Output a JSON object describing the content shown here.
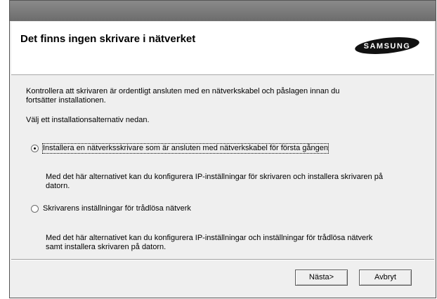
{
  "header": {
    "title": "Det finns ingen skrivare i nätverket",
    "logo_text": "SAMSUNG"
  },
  "content": {
    "intro_line1": "Kontrollera att skrivaren är ordentligt ansluten med en nätverkskabel och påslagen innan du",
    "intro_line2": "fortsätter installationen.",
    "select_prompt": "Välj ett installationsalternativ nedan.",
    "option1": {
      "label": "Installera en nätverksskrivare som är ansluten med nätverkskabel för första gången",
      "selected": true,
      "desc_line1": "Med det här alternativet kan du konfigurera IP-inställningar för skrivaren och installera skrivaren på",
      "desc_line2": "datorn."
    },
    "option2": {
      "label": "Skrivarens inställningar för trådlösa nätverk",
      "selected": false,
      "desc_line1": "Med det här alternativet kan du konfigurera IP-inställningar och inställningar för trådlösa nätverk",
      "desc_line2": "samt installera skrivaren på datorn."
    }
  },
  "buttons": {
    "next_label": "Nästa>",
    "cancel_label": "Avbryt"
  }
}
